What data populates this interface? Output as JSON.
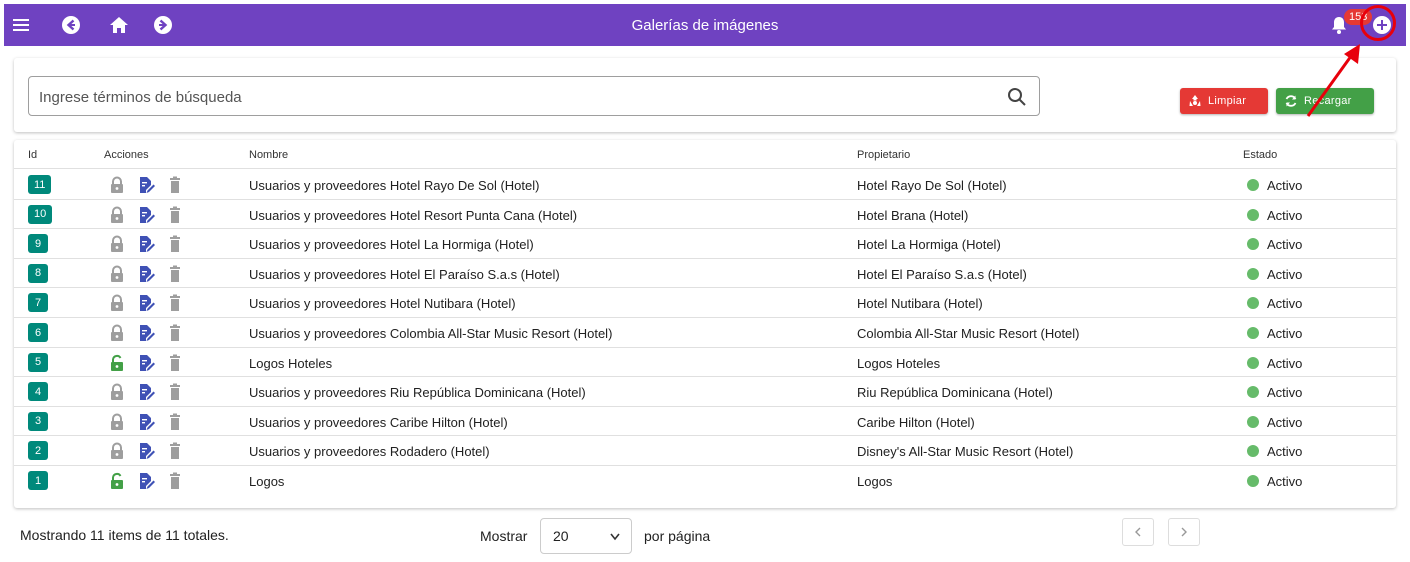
{
  "header": {
    "title": "Galerías de imágenes",
    "notification_count": "153",
    "color": "#6f42c1"
  },
  "search": {
    "placeholder": "Ingrese términos de búsqueda",
    "value": ""
  },
  "toolbar": {
    "clear_label": "Limpiar",
    "reload_label": "Recargar"
  },
  "table": {
    "columns": {
      "id": "Id",
      "actions": "Acciones",
      "name": "Nombre",
      "owner": "Propietario",
      "status": "Estado"
    },
    "rows": [
      {
        "id": "11",
        "unlocked": false,
        "name": "Usuarios y proveedores Hotel Rayo De Sol (Hotel)",
        "owner": "Hotel Rayo De Sol (Hotel)",
        "status": "Activo"
      },
      {
        "id": "10",
        "unlocked": false,
        "name": "Usuarios y proveedores Hotel Resort Punta Cana (Hotel)",
        "owner": "Hotel Brana (Hotel)",
        "status": "Activo"
      },
      {
        "id": "9",
        "unlocked": false,
        "name": "Usuarios y proveedores Hotel La Hormiga (Hotel)",
        "owner": "Hotel La Hormiga (Hotel)",
        "status": "Activo"
      },
      {
        "id": "8",
        "unlocked": false,
        "name": "Usuarios y proveedores Hotel El Paraíso S.a.s (Hotel)",
        "owner": "Hotel El Paraíso S.a.s (Hotel)",
        "status": "Activo"
      },
      {
        "id": "7",
        "unlocked": false,
        "name": "Usuarios y proveedores Hotel Nutibara (Hotel)",
        "owner": "Hotel Nutibara (Hotel)",
        "status": "Activo"
      },
      {
        "id": "6",
        "unlocked": false,
        "name": "Usuarios y proveedores Colombia All-Star Music Resort (Hotel)",
        "owner": "Colombia All-Star Music Resort (Hotel)",
        "status": "Activo"
      },
      {
        "id": "5",
        "unlocked": true,
        "name": "Logos Hoteles",
        "owner": "Logos Hoteles",
        "status": "Activo"
      },
      {
        "id": "4",
        "unlocked": false,
        "name": "Usuarios y proveedores Riu República Dominicana (Hotel)",
        "owner": "Riu República Dominicana (Hotel)",
        "status": "Activo"
      },
      {
        "id": "3",
        "unlocked": false,
        "name": "Usuarios y proveedores Caribe Hilton (Hotel)",
        "owner": "Caribe Hilton (Hotel)",
        "status": "Activo"
      },
      {
        "id": "2",
        "unlocked": false,
        "name": "Usuarios y proveedores Rodadero (Hotel)",
        "owner": "Disney's All-Star Music Resort (Hotel)",
        "status": "Activo"
      },
      {
        "id": "1",
        "unlocked": true,
        "name": "Logos",
        "owner": "Logos",
        "status": "Activo"
      }
    ]
  },
  "footer": {
    "summary": "Mostrando 11 items de 11 totales.",
    "show_label": "Mostrar",
    "page_size": "20",
    "per_page_label": "por página"
  },
  "colors": {
    "id_chip": "#00897b",
    "locked_icon": "#9e9e9e",
    "unlocked_icon": "#43a047",
    "edit_icon": "#3f51b5",
    "status_active": "#66bb6a",
    "clear_button": "#e53935",
    "reload_button": "#43a047"
  }
}
